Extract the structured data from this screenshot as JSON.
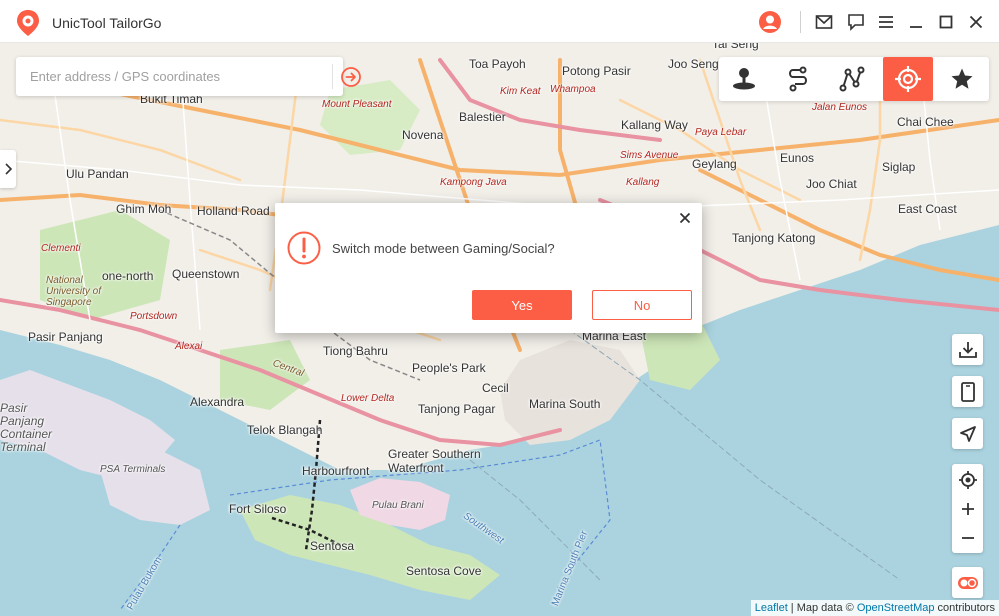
{
  "app": {
    "title": "UnicTool TailorGo",
    "accent_color": "#fb5e45"
  },
  "titlebar": {
    "icons": [
      "user-avatar-icon",
      "mail-icon",
      "feedback-icon",
      "menu-icon",
      "minimize-icon",
      "maximize-icon",
      "close-icon"
    ]
  },
  "search": {
    "placeholder": "Enter address / GPS coordinates",
    "value": ""
  },
  "modes": [
    {
      "name": "teleport-mode",
      "icon": "teleport-icon",
      "active": false
    },
    {
      "name": "two-spot-mode",
      "icon": "two-spot-route-icon",
      "active": false
    },
    {
      "name": "multi-spot-mode",
      "icon": "multi-spot-route-icon",
      "active": false
    },
    {
      "name": "game-mode",
      "icon": "crosshair-icon",
      "active": true
    },
    {
      "name": "favorites",
      "icon": "star-icon",
      "active": false
    }
  ],
  "map": {
    "labels": [
      {
        "text": "Tai Seng"
      },
      {
        "text": "Toa Payoh"
      },
      {
        "text": "Potong Pasir"
      },
      {
        "text": "Joo Seng"
      },
      {
        "text": "Bukit Timah"
      },
      {
        "text": "Mount Pleasant"
      },
      {
        "text": "Kim Keat"
      },
      {
        "text": "Whampoa"
      },
      {
        "text": "Balestier"
      },
      {
        "text": "Novena"
      },
      {
        "text": "Kallang Way"
      },
      {
        "text": "Jalan Eunos"
      },
      {
        "text": "Chai Chee"
      },
      {
        "text": "Paya Lebar"
      },
      {
        "text": "Sims Avenue"
      },
      {
        "text": "Geylang"
      },
      {
        "text": "Eunos"
      },
      {
        "text": "Ulu Pandan"
      },
      {
        "text": "Kampong Java"
      },
      {
        "text": "Kallang"
      },
      {
        "text": "Joo Chiat"
      },
      {
        "text": "Siglap"
      },
      {
        "text": "Ghim Moh"
      },
      {
        "text": "Holland Road"
      },
      {
        "text": "East Coast"
      },
      {
        "text": "Tanjong Katong"
      },
      {
        "text": "one-north"
      },
      {
        "text": "Queenstown"
      },
      {
        "text": "National University of Singapore"
      },
      {
        "text": "Pasir Panjang"
      },
      {
        "text": "Tiong Bahru"
      },
      {
        "text": "Marina East"
      },
      {
        "text": "People's Park"
      },
      {
        "text": "Alexandra"
      },
      {
        "text": "Cecil"
      },
      {
        "text": "Marina South"
      },
      {
        "text": "Tanjong Pagar"
      },
      {
        "text": "Lower Delta"
      },
      {
        "text": "Telok Blangah"
      },
      {
        "text": "Pasir Panjang Container Terminal"
      },
      {
        "text": "Greater Southern Waterfront"
      },
      {
        "text": "Harbourfront"
      },
      {
        "text": "PSA Terminals"
      },
      {
        "text": "Pulau Brani"
      },
      {
        "text": "Fort Siloso"
      },
      {
        "text": "Sentosa"
      },
      {
        "text": "Sentosa Cove"
      },
      {
        "text": "Southwest"
      },
      {
        "text": "Marina South Pier"
      },
      {
        "text": "Pulau Bukom"
      },
      {
        "text": "Clementi"
      },
      {
        "text": "Portsdown"
      },
      {
        "text": "Alexai"
      },
      {
        "text": "Central"
      }
    ]
  },
  "modal": {
    "message": "Switch mode between Gaming/Social?",
    "yes_label": "Yes",
    "no_label": "No"
  },
  "attribution": {
    "leaflet": "Leaflet",
    "separator": " | Map data © ",
    "osm": "OpenStreetMap",
    "suffix": " contributors"
  }
}
